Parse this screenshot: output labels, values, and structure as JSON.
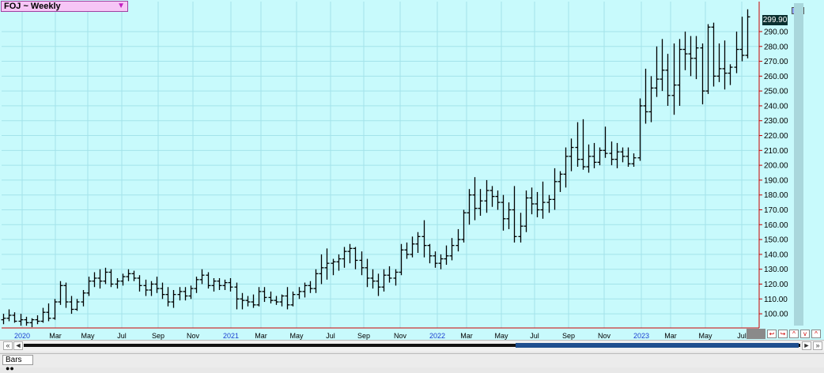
{
  "window": {
    "symbol_label": "FOJ ~ Weekly",
    "dropdown_icon": "triangle-down-icon"
  },
  "price_tag": "299.90",
  "tab": {
    "label": "Bars"
  },
  "scroll": {
    "left_arrow": "«",
    "prev": "◄",
    "next": "►",
    "right_arrow": "»"
  },
  "colors": {
    "background": "#c8fafc",
    "grid": "#a3e3ea",
    "bars": "#000000",
    "axis": "#cc0000"
  },
  "chart_data": {
    "type": "bar",
    "ohlc": true,
    "yticks": [
      100,
      110,
      120,
      130,
      140,
      150,
      160,
      170,
      180,
      190,
      200,
      210,
      220,
      230,
      240,
      250,
      260,
      270,
      280,
      290
    ],
    "ytick_labels": [
      "100.00",
      "110.00",
      "120.00",
      "130.00",
      "140.00",
      "150.00",
      "160.00",
      "170.00",
      "180.00",
      "190.00",
      "200.00",
      "210.00",
      "220.00",
      "230.00",
      "240.00",
      "250.00",
      "260.00",
      "270.00",
      "280.00",
      "290.00"
    ],
    "ylim": [
      91,
      307
    ],
    "x_labels": [
      "2020",
      "Mar",
      "May",
      "Jul",
      "Sep",
      "Nov",
      "2021",
      "Mar",
      "May",
      "Jul",
      "Sep",
      "Nov",
      "2022",
      "Mar",
      "May",
      "Jul",
      "Sep",
      "Nov",
      "2023",
      "Mar",
      "May",
      "Jul"
    ],
    "x_label_is_year": [
      true,
      false,
      false,
      false,
      false,
      false,
      true,
      false,
      false,
      false,
      false,
      false,
      true,
      false,
      false,
      false,
      false,
      false,
      true,
      false,
      false,
      false
    ],
    "last_price": 299.9,
    "series": [
      {
        "values": [
          [
            96,
            100,
            93,
            97
          ],
          [
            97,
            103,
            95,
            99
          ],
          [
            99,
            101,
            94,
            95
          ],
          [
            95,
            100,
            92,
            96
          ],
          [
            96,
            98,
            92,
            94
          ],
          [
            94,
            97,
            91,
            96
          ],
          [
            96,
            99,
            93,
            95
          ],
          [
            95,
            104,
            94,
            101
          ],
          [
            101,
            107,
            95,
            97
          ],
          [
            97,
            110,
            96,
            108
          ],
          [
            108,
            122,
            106,
            119
          ],
          [
            119,
            121,
            104,
            108
          ],
          [
            108,
            112,
            100,
            103
          ],
          [
            103,
            110,
            102,
            108
          ],
          [
            108,
            116,
            105,
            114
          ],
          [
            114,
            125,
            112,
            122
          ],
          [
            122,
            128,
            118,
            124
          ],
          [
            124,
            130,
            117,
            122
          ],
          [
            122,
            131,
            120,
            128
          ],
          [
            128,
            130,
            118,
            120
          ],
          [
            120,
            124,
            117,
            122
          ],
          [
            122,
            127,
            119,
            125
          ],
          [
            125,
            130,
            122,
            127
          ],
          [
            127,
            129,
            122,
            124
          ],
          [
            124,
            126,
            115,
            119
          ],
          [
            119,
            123,
            112,
            116
          ],
          [
            116,
            122,
            112,
            120
          ],
          [
            120,
            125,
            114,
            117
          ],
          [
            117,
            121,
            110,
            113
          ],
          [
            113,
            118,
            105,
            108
          ],
          [
            108,
            116,
            104,
            113
          ],
          [
            113,
            118,
            109,
            115
          ],
          [
            115,
            118,
            109,
            112
          ],
          [
            112,
            119,
            110,
            117
          ],
          [
            117,
            125,
            114,
            123
          ],
          [
            123,
            130,
            120,
            126
          ],
          [
            126,
            128,
            117,
            119
          ],
          [
            119,
            124,
            115,
            122
          ],
          [
            122,
            124,
            116,
            119
          ],
          [
            119,
            123,
            116,
            121
          ],
          [
            121,
            124,
            115,
            118
          ],
          [
            118,
            121,
            103,
            110
          ],
          [
            110,
            114,
            103,
            109
          ],
          [
            109,
            112,
            105,
            108
          ],
          [
            108,
            113,
            104,
            106
          ],
          [
            106,
            118,
            105,
            115
          ],
          [
            115,
            118,
            108,
            111
          ],
          [
            111,
            115,
            107,
            109
          ],
          [
            109,
            112,
            106,
            108
          ],
          [
            108,
            113,
            105,
            112
          ],
          [
            112,
            118,
            103,
            106
          ],
          [
            106,
            115,
            105,
            113
          ],
          [
            113,
            118,
            110,
            115
          ],
          [
            115,
            121,
            111,
            119
          ],
          [
            119,
            122,
            114,
            117
          ],
          [
            117,
            130,
            114,
            127
          ],
          [
            127,
            140,
            120,
            131
          ],
          [
            131,
            144,
            123,
            134
          ],
          [
            134,
            137,
            126,
            135
          ],
          [
            135,
            140,
            129,
            137
          ],
          [
            137,
            145,
            131,
            142
          ],
          [
            142,
            147,
            134,
            144
          ],
          [
            144,
            145,
            130,
            136
          ],
          [
            136,
            142,
            126,
            131
          ],
          [
            131,
            137,
            118,
            124
          ],
          [
            124,
            130,
            117,
            122
          ],
          [
            122,
            127,
            112,
            118
          ],
          [
            118,
            130,
            115,
            126
          ],
          [
            126,
            132,
            121,
            124
          ],
          [
            124,
            130,
            119,
            128
          ],
          [
            128,
            147,
            126,
            143
          ],
          [
            143,
            148,
            137,
            140
          ],
          [
            140,
            152,
            138,
            147
          ],
          [
            147,
            155,
            141,
            152
          ],
          [
            152,
            163,
            138,
            146
          ],
          [
            146,
            147,
            134,
            139
          ],
          [
            139,
            142,
            131,
            134
          ],
          [
            134,
            140,
            130,
            137
          ],
          [
            137,
            146,
            133,
            139
          ],
          [
            139,
            151,
            136,
            146
          ],
          [
            146,
            157,
            142,
            150
          ],
          [
            150,
            170,
            148,
            168
          ],
          [
            168,
            184,
            160,
            180
          ],
          [
            180,
            192,
            163,
            171
          ],
          [
            171,
            184,
            166,
            176
          ],
          [
            176,
            190,
            168,
            183
          ],
          [
            183,
            186,
            172,
            179
          ],
          [
            179,
            183,
            170,
            175
          ],
          [
            175,
            180,
            156,
            164
          ],
          [
            164,
            175,
            157,
            170
          ],
          [
            170,
            186,
            148,
            152
          ],
          [
            152,
            168,
            148,
            159
          ],
          [
            159,
            183,
            155,
            178
          ],
          [
            178,
            185,
            167,
            174
          ],
          [
            174,
            182,
            165,
            170
          ],
          [
            170,
            189,
            164,
            175
          ],
          [
            175,
            180,
            168,
            177
          ],
          [
            177,
            198,
            170,
            189
          ],
          [
            189,
            196,
            182,
            194
          ],
          [
            194,
            212,
            185,
            206
          ],
          [
            206,
            218,
            196,
            212
          ],
          [
            212,
            229,
            199,
            204
          ],
          [
            204,
            231,
            197,
            199
          ],
          [
            199,
            214,
            195,
            206
          ],
          [
            206,
            215,
            198,
            202
          ],
          [
            202,
            212,
            200,
            210
          ],
          [
            210,
            226,
            205,
            208
          ],
          [
            208,
            216,
            200,
            204
          ],
          [
            204,
            215,
            198,
            209
          ],
          [
            209,
            212,
            202,
            206
          ],
          [
            206,
            212,
            199,
            201
          ],
          [
            201,
            208,
            199,
            205
          ],
          [
            205,
            245,
            203,
            240
          ],
          [
            240,
            265,
            228,
            236
          ],
          [
            236,
            260,
            229,
            252
          ],
          [
            252,
            280,
            246,
            258
          ],
          [
            258,
            285,
            250,
            264
          ],
          [
            264,
            275,
            240,
            247
          ],
          [
            247,
            282,
            234,
            254
          ],
          [
            254,
            285,
            240,
            278
          ],
          [
            278,
            290,
            264,
            275
          ],
          [
            275,
            287,
            260,
            272
          ],
          [
            272,
            287,
            258,
            279
          ],
          [
            279,
            282,
            241,
            250
          ],
          [
            250,
            295,
            248,
            293
          ],
          [
            293,
            296,
            253,
            260
          ],
          [
            260,
            282,
            256,
            265
          ],
          [
            265,
            284,
            251,
            262
          ],
          [
            262,
            268,
            254,
            266
          ],
          [
            266,
            290,
            262,
            278
          ],
          [
            278,
            300,
            270,
            274
          ],
          [
            274,
            305,
            272,
            299.9
          ]
        ]
      }
    ]
  }
}
